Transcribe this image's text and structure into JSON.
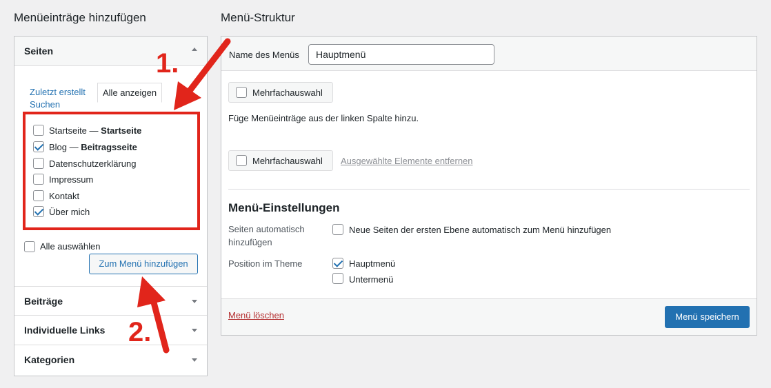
{
  "left": {
    "title": "Menüeinträge hinzufügen",
    "pages": {
      "header": "Seiten",
      "tab_recent": "Zuletzt erstellt",
      "tab_all": "Alle anzeigen",
      "tab_search": "Suchen",
      "items": [
        {
          "label": "Startseite",
          "suffix": "Startseite",
          "checked": false
        },
        {
          "label": "Blog",
          "suffix": "Beitragsseite",
          "checked": true
        },
        {
          "label": "Datenschutzerklärung",
          "suffix": "",
          "checked": false
        },
        {
          "label": "Impressum",
          "suffix": "",
          "checked": false
        },
        {
          "label": "Kontakt",
          "suffix": "",
          "checked": false
        },
        {
          "label": "Über mich",
          "suffix": "",
          "checked": true
        }
      ],
      "dash": " — ",
      "select_all": "Alle auswählen",
      "add_button": "Zum Menü hinzufügen"
    },
    "sections": [
      "Beiträge",
      "Individuelle Links",
      "Kategorien"
    ]
  },
  "right": {
    "title": "Menü-Struktur",
    "menu_name_label": "Name des Menüs",
    "menu_name_value": "Hauptmenü",
    "bulk_select": "Mehrfachauswahl",
    "hint": "Füge Menüeinträge aus der linken Spalte hinzu.",
    "remove_selected": "Ausgewählte Elemente entfernen",
    "settings": {
      "title": "Menü-Einstellungen",
      "auto_add_label_1": "Seiten automatisch",
      "auto_add_label_2": "hinzufügen",
      "auto_add_option": "Neue Seiten der ersten Ebene automatisch zum Menü hinzufügen",
      "position_label": "Position im Theme",
      "positions": [
        {
          "label": "Hauptmenü",
          "checked": true
        },
        {
          "label": "Untermenü",
          "checked": false
        }
      ]
    },
    "delete_menu": "Menü löschen",
    "save_menu": "Menü speichern"
  },
  "annotations": {
    "step1": "1.",
    "step2": "2."
  },
  "colors": {
    "accent": "#2271b1",
    "annotation_red": "#e1251b",
    "danger": "#b32d2e"
  }
}
